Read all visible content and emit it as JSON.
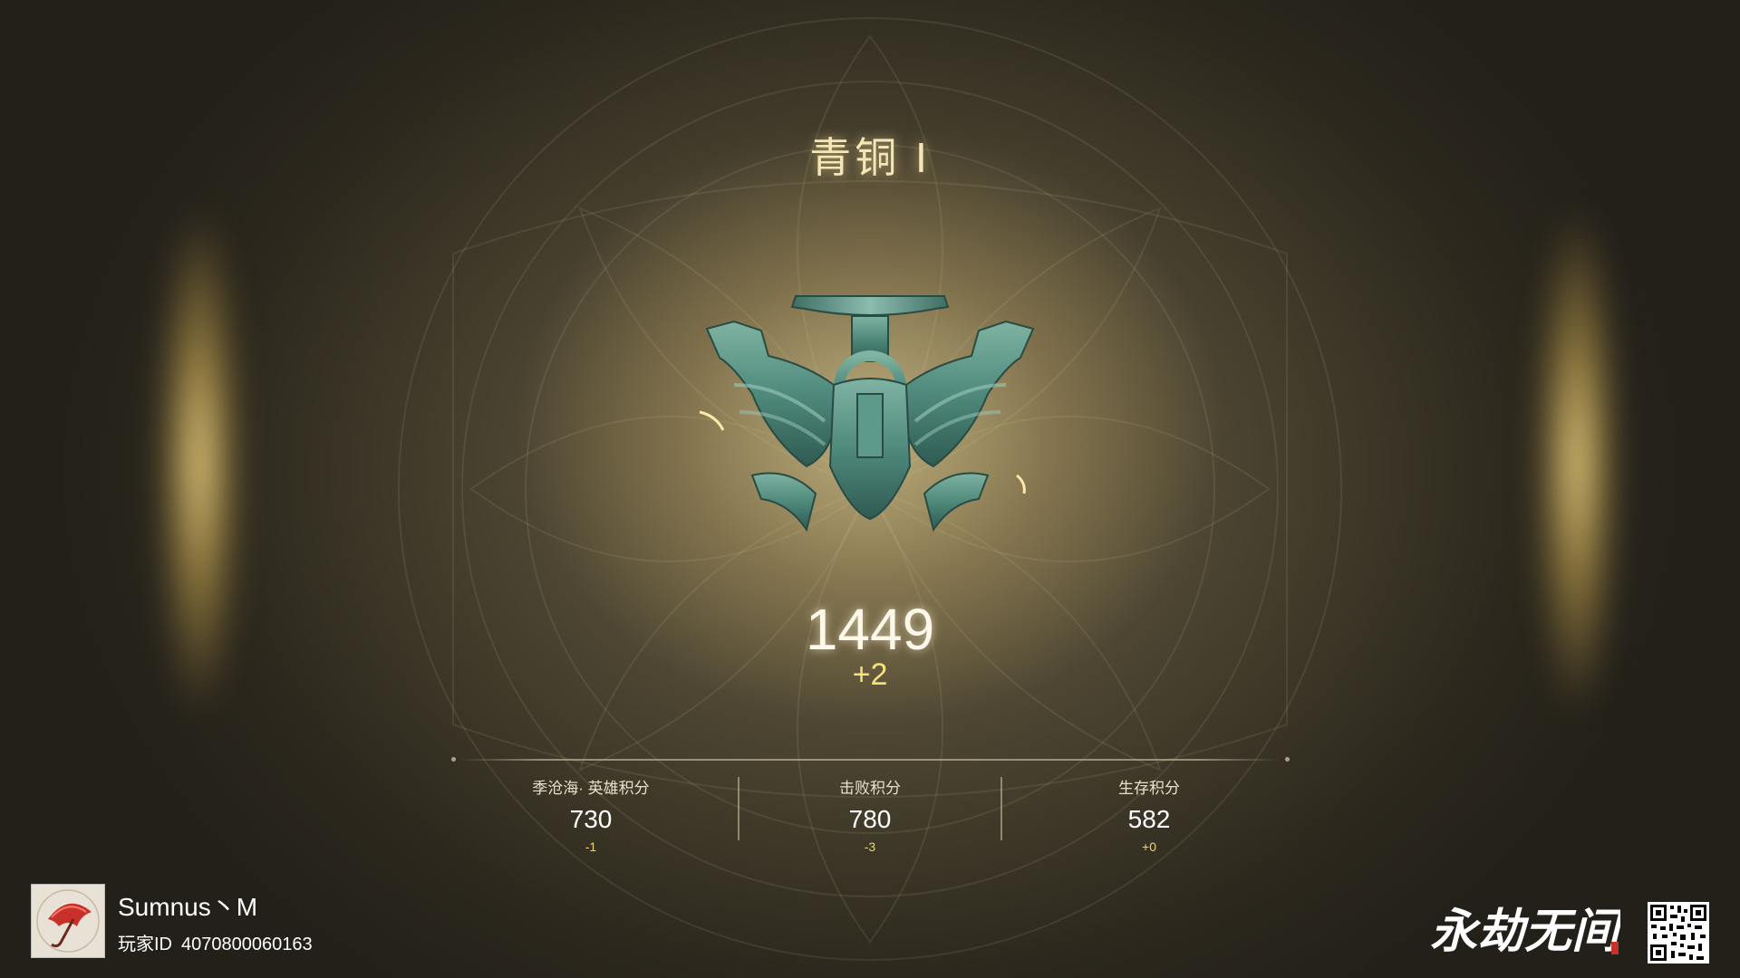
{
  "rank": {
    "title": "青铜 I",
    "score": "1449",
    "score_delta": "+2"
  },
  "stats": [
    {
      "label": "季沧海· 英雄积分",
      "value": "730",
      "delta": "-1"
    },
    {
      "label": "击败积分",
      "value": "780",
      "delta": "-3"
    },
    {
      "label": "生存积分",
      "value": "582",
      "delta": "+0"
    }
  ],
  "player": {
    "name": "Sumnus丶M",
    "id_label": "玩家ID",
    "id_value": "4070800060163"
  },
  "logo_text": "永劫无间",
  "icons": {
    "emblem": "bronze-rank-emblem-icon",
    "avatar": "red-umbrella-avatar",
    "qr": "qr-code-icon"
  },
  "colors": {
    "title": "#f3e7b8",
    "delta": "#f4e27a",
    "bronze": "#4f8a7c"
  }
}
